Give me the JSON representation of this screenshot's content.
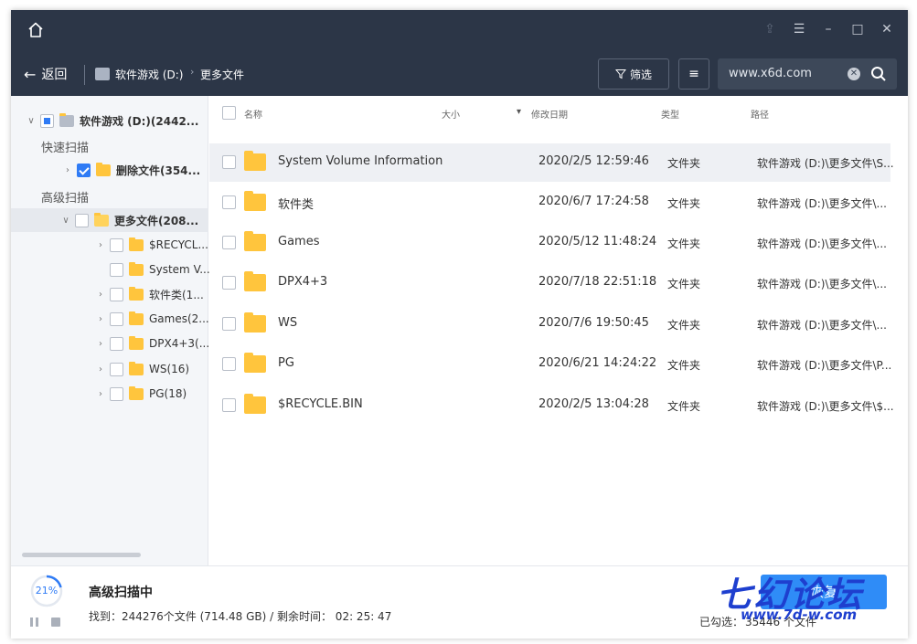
{
  "titlebar": {
    "back_label": "返回",
    "drive_crumb": "软件游戏 (D:)",
    "folder_crumb": "更多文件",
    "filter_label": "筛选",
    "search_value": "www.x6d.com"
  },
  "sidebar": {
    "root_label": "软件游戏 (D:)(2442...",
    "quick_scan_label": "快速扫描",
    "deleted_label": "删除文件(354...",
    "advanced_scan_label": "高级扫描",
    "more_label": "更多文件(208...",
    "children": [
      {
        "label": "$RECYCL...",
        "expandable": true
      },
      {
        "label": "System V...",
        "expandable": false
      },
      {
        "label": "软件类(1...",
        "expandable": true
      },
      {
        "label": "Games(2...",
        "expandable": true
      },
      {
        "label": "DPX4+3(...",
        "expandable": true
      },
      {
        "label": "WS(16)",
        "expandable": true
      },
      {
        "label": "PG(18)",
        "expandable": true
      }
    ]
  },
  "table": {
    "headers": {
      "name": "名称",
      "size": "大小",
      "date": "修改日期",
      "type": "类型",
      "path": "路径"
    },
    "rows": [
      {
        "name": "System Volume Information",
        "date": "2020/2/5 12:59:46",
        "type": "文件夹",
        "path": "软件游戏 (D:)\\更多文件\\S..."
      },
      {
        "name": "软件类",
        "date": "2020/6/7 17:24:58",
        "type": "文件夹",
        "path": "软件游戏 (D:)\\更多文件\\..."
      },
      {
        "name": "Games",
        "date": "2020/5/12 11:48:24",
        "type": "文件夹",
        "path": "软件游戏 (D:)\\更多文件\\..."
      },
      {
        "name": "DPX4+3",
        "date": "2020/7/18 22:51:18",
        "type": "文件夹",
        "path": "软件游戏 (D:)\\更多文件\\..."
      },
      {
        "name": "WS",
        "date": "2020/7/6 19:50:45",
        "type": "文件夹",
        "path": "软件游戏 (D:)\\更多文件\\..."
      },
      {
        "name": "PG",
        "date": "2020/6/21 14:24:22",
        "type": "文件夹",
        "path": "软件游戏 (D:)\\更多文件\\P..."
      },
      {
        "name": "$RECYCLE.BIN",
        "date": "2020/2/5 13:04:28",
        "type": "文件夹",
        "path": "软件游戏 (D:)\\更多文件\\$..."
      }
    ]
  },
  "status": {
    "progress_percent": "21%",
    "progress_fraction": 0.21,
    "title": "高级扫描中",
    "info": "找到：244276个文件 (714.48 GB) / 剩余时间： 02: 25: 47",
    "selected_label": "已勾选：",
    "selected_value": "35446 个文件",
    "recover_label": "恢复"
  },
  "watermark": {
    "big": "七幻论坛",
    "small": "www.7d-w.com"
  },
  "colors": {
    "titlebar": "#2c3647",
    "accent": "#2f7bf5",
    "folder": "#ffc53d"
  }
}
